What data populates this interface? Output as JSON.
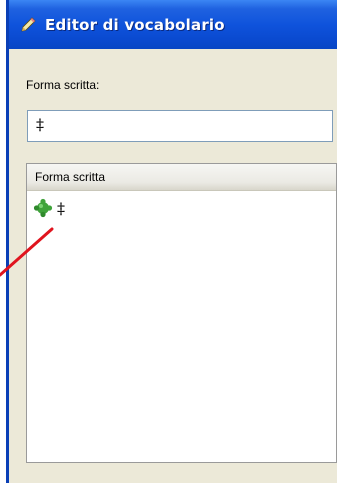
{
  "window": {
    "title": "Editor di vocabolario",
    "title_icon": "pencil-icon"
  },
  "form": {
    "written_label": "Forma scritta:",
    "written_value": "‡"
  },
  "list": {
    "column_header": "Forma scritta",
    "rows": [
      {
        "icon": "green-puzzle-icon",
        "text": "‡"
      }
    ]
  },
  "colors": {
    "titlebar": "#0f53dc",
    "window_bg": "#ece9d8",
    "pointer_line": "#e0141e"
  }
}
